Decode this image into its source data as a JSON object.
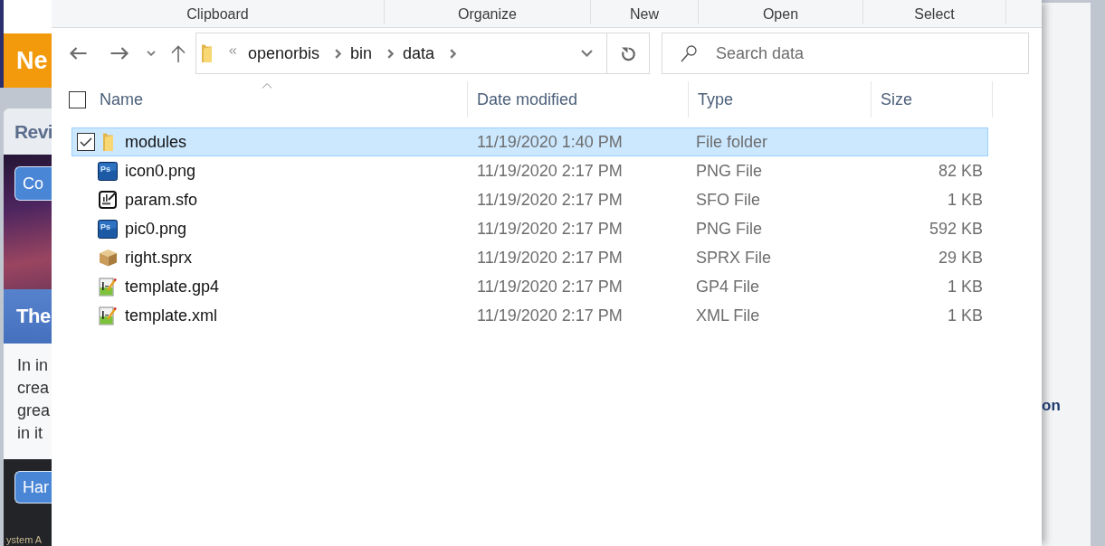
{
  "background_left": {
    "banner": "Ne",
    "card_heading": "Revi",
    "photo_button": "Co",
    "article_title": "The",
    "excerpt_lines": [
      "In in",
      "crea",
      "grea",
      "in it"
    ],
    "footer_button": "Har",
    "footer_text": "ystem A"
  },
  "ribbon": {
    "groups": [
      "Clipboard",
      "Organize",
      "New",
      "Open",
      "Select"
    ]
  },
  "address_bar": {
    "path": [
      "openorbis",
      "bin",
      "data"
    ]
  },
  "search": {
    "placeholder": "Search data"
  },
  "file_list": {
    "select_all": {
      "checked": false
    },
    "columns": [
      "Name",
      "Date modified",
      "Type",
      "Size"
    ],
    "rows": [
      {
        "name": "modules",
        "kind": "folder",
        "date_modified": "11/19/2020 1:40 PM",
        "type": "File folder",
        "selected": true
      },
      {
        "name": "icon0.png",
        "kind": "photoshop",
        "icon_label": "Ps",
        "date_modified": "11/19/2020 2:17 PM",
        "type": "PNG File",
        "size": "82 KB",
        "selected": false
      },
      {
        "name": "param.sfo",
        "kind": "settings",
        "date_modified": "11/19/2020 2:17 PM",
        "type": "SFO File",
        "size": "1 KB",
        "selected": false
      },
      {
        "name": "pic0.png",
        "kind": "photoshop",
        "icon_label": "Ps",
        "date_modified": "11/19/2020 2:17 PM",
        "type": "PNG File",
        "size": "592 KB",
        "selected": false
      },
      {
        "name": "right.sprx",
        "kind": "package",
        "date_modified": "11/19/2020 2:17 PM",
        "type": "SPRX File",
        "size": "29 KB",
        "selected": false
      },
      {
        "name": "template.gp4",
        "kind": "template",
        "date_modified": "11/19/2020 2:17 PM",
        "type": "GP4 File",
        "size": "1 KB",
        "selected": false
      },
      {
        "name": "template.xml",
        "kind": "template",
        "date_modified": "11/19/2020 2:17 PM",
        "type": "XML File",
        "size": "1 KB",
        "selected": false
      }
    ]
  },
  "background_right": {
    "heading_fragment": "on"
  }
}
